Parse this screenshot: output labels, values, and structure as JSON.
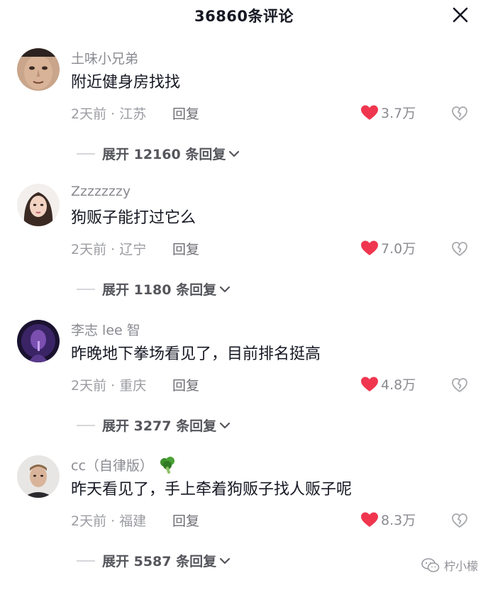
{
  "header": {
    "title": "36860条评论"
  },
  "comments": [
    {
      "username": "土味小兄弟",
      "text": "附近健身房找找",
      "time_location": "2天前 · 江苏",
      "reply_label": "回复",
      "likes": "3.7万",
      "expand_label": "展开 12160 条回复"
    },
    {
      "username": "Zzzzzzzy",
      "text": "狗贩子能打过它么",
      "time_location": "2天前 · 辽宁",
      "reply_label": "回复",
      "likes": "7.0万",
      "expand_label": "展开 1180 条回复"
    },
    {
      "username": "李志 lee 智",
      "text": "昨晚地下拳场看见了，目前排名挺高",
      "time_location": "2天前 · 重庆",
      "reply_label": "回复",
      "likes": "4.8万",
      "expand_label": "展开 3277 条回复"
    },
    {
      "username": "cc（自律版）",
      "text": "昨天看见了，手上牵着狗贩子找人贩子呢",
      "time_location": "2天前 · 福建",
      "reply_label": "回复",
      "likes": "8.3万",
      "expand_label": "展开 5587 条回复",
      "badge_icon": "broccoli-icon"
    }
  ],
  "watermark": {
    "text": "柠小檬"
  },
  "colors": {
    "like_red": "#f0364f",
    "muted_text": "#8a8b91",
    "primary_text": "#161823"
  }
}
